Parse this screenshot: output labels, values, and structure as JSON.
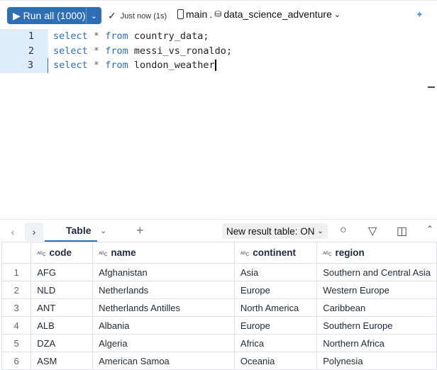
{
  "toolbar": {
    "run_label": "Run all (1000)",
    "status": "Just now (1s)",
    "catalog": "main",
    "separator": ".",
    "schema": "data_science_adventure"
  },
  "editor": {
    "lines": [
      {
        "num": "1",
        "kw": "select",
        "op": "*",
        "from": "from",
        "table": "country_data",
        "end": ";"
      },
      {
        "num": "2",
        "kw": "select",
        "op": "*",
        "from": "from",
        "table": "messi_vs_ronaldo",
        "end": ";"
      },
      {
        "num": "3",
        "kw": "select",
        "op": "*",
        "from": "from",
        "table": "london_weather",
        "end": ""
      }
    ]
  },
  "results": {
    "tab_label": "Table",
    "new_result_table": "New result table: ON",
    "columns": [
      "code",
      "name",
      "continent",
      "region"
    ],
    "rows": [
      [
        "1",
        "AFG",
        "Afghanistan",
        "Asia",
        "Southern and Central Asia"
      ],
      [
        "2",
        "NLD",
        "Netherlands",
        "Europe",
        "Western Europe"
      ],
      [
        "3",
        "ANT",
        "Netherlands Antilles",
        "North America",
        "Caribbean"
      ],
      [
        "4",
        "ALB",
        "Albania",
        "Europe",
        "Southern Europe"
      ],
      [
        "5",
        "DZA",
        "Algeria",
        "Africa",
        "Northern Africa"
      ],
      [
        "6",
        "ASM",
        "American Samoa",
        "Oceania",
        "Polynesia"
      ]
    ]
  },
  "colors": {
    "accent": "#2f6eb5",
    "gutter_highlight": "#dfedfb"
  }
}
